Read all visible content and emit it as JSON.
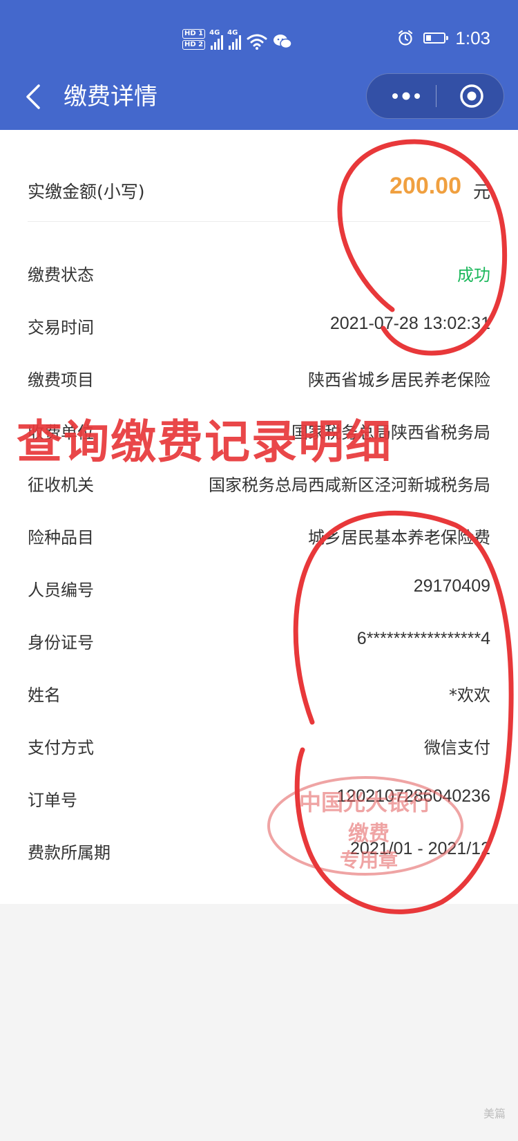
{
  "status_bar": {
    "hd_badges": [
      "HD 1",
      "HD 2"
    ],
    "network_type": "4G",
    "signal_icons": [
      "signal-bars-icon",
      "signal-bars-icon"
    ],
    "wifi_icon": "wifi-icon",
    "wechat_icon": "wechat-icon",
    "alarm_icon": "alarm-clock-icon",
    "battery_level": 0.3,
    "time": "1:03"
  },
  "header": {
    "title": "缴费详情",
    "back_icon": "chevron-left-icon",
    "more_icon": "more-dots-icon",
    "close_icon": "target-circle-icon"
  },
  "amount": {
    "label": "实缴金额(小写)",
    "value": "200.00",
    "unit": "元"
  },
  "details": [
    {
      "label": "缴费状态",
      "value": "成功"
    },
    {
      "label": "交易时间",
      "value": "2021-07-28 13:02:31"
    },
    {
      "label": "缴费项目",
      "value": "陕西省城乡居民养老保险"
    },
    {
      "label": "收费单位",
      "value": "国家税务总局陕西省税务局"
    },
    {
      "label": "征收机关",
      "value": "国家税务总局西咸新区泾河新城税务局"
    },
    {
      "label": "险种品目",
      "value": "城乡居民基本养老保险费"
    },
    {
      "label": "人员编号",
      "value": "29170409"
    },
    {
      "label": "身份证号",
      "value": "6*****************4"
    },
    {
      "label": "姓名",
      "value": "*欢欢"
    },
    {
      "label": "支付方式",
      "value": "微信支付"
    },
    {
      "label": "订单号",
      "value": "1202107286040236"
    },
    {
      "label": "费款所属期",
      "value": "2021/01 - 2021/12"
    }
  ],
  "overlay": {
    "banner": "查询缴费记录明细",
    "seal": {
      "line1": "中国光大银行",
      "line2": "缴费",
      "line3": "专用章"
    },
    "watermark": "美篇"
  },
  "colors": {
    "header_bg": "#4468cc",
    "amount": "#f0a040",
    "success": "#1cb85c",
    "annotation_red": "#e8383a"
  }
}
